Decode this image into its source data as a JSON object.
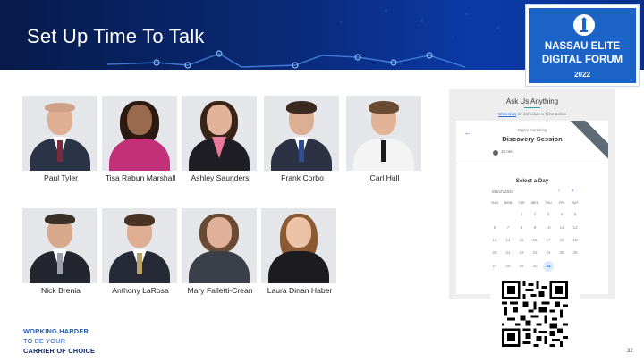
{
  "slide": {
    "title": "Set Up Time To Talk",
    "page_number": "32"
  },
  "logo": {
    "line1": "NASSAU ELITE",
    "line2": "DIGITAL FORUM",
    "year": "2022"
  },
  "people_row1": [
    {
      "name": "Paul Tyler"
    },
    {
      "name": "Tisa Rabun Marshall"
    },
    {
      "name": "Ashley Saunders"
    },
    {
      "name": "Frank Corbo"
    },
    {
      "name": "Carl Hull"
    }
  ],
  "people_row2": [
    {
      "name": "Nick Brenia"
    },
    {
      "name": "Anthony LaRosa"
    },
    {
      "name": "Mary Falletti-Crean"
    },
    {
      "name": "Laura Dinan Haber"
    }
  ],
  "scheduler": {
    "title": "Ask Us Anything",
    "link_text": "Chat Now",
    "subtitle_rest": " Or Schedule a Time Below",
    "category": "Digital Marketing",
    "session_title": "Discovery Session",
    "duration": "15 min",
    "select_day": "Select a Day",
    "month": "March 2022",
    "weekdays": [
      "SUN",
      "MON",
      "TUE",
      "WED",
      "THU",
      "FRI",
      "SAT"
    ],
    "weeks": [
      [
        "",
        "",
        "1",
        "2",
        "3",
        "4",
        "5"
      ],
      [
        "6",
        "7",
        "8",
        "9",
        "10",
        "11",
        "12"
      ],
      [
        "13",
        "14",
        "15",
        "16",
        "17",
        "18",
        "19"
      ],
      [
        "20",
        "21",
        "22",
        "23",
        "24",
        "25",
        "26"
      ],
      [
        "27",
        "28",
        "29",
        "30",
        "31",
        "",
        ""
      ]
    ],
    "selected_day": "31"
  },
  "tagline": {
    "line1": "WORKING HARDER",
    "line2": "TO BE YOUR",
    "line3": "CARRIER OF CHOICE"
  },
  "colors": {
    "banner_dark": "#071a4a",
    "banner_blue": "#0b3aa8",
    "logo_blue": "#1b63c6",
    "tagline_blue": "#1f5bb8",
    "tagline_dark": "#0d2a66",
    "accent_link": "#1f6fe0"
  }
}
